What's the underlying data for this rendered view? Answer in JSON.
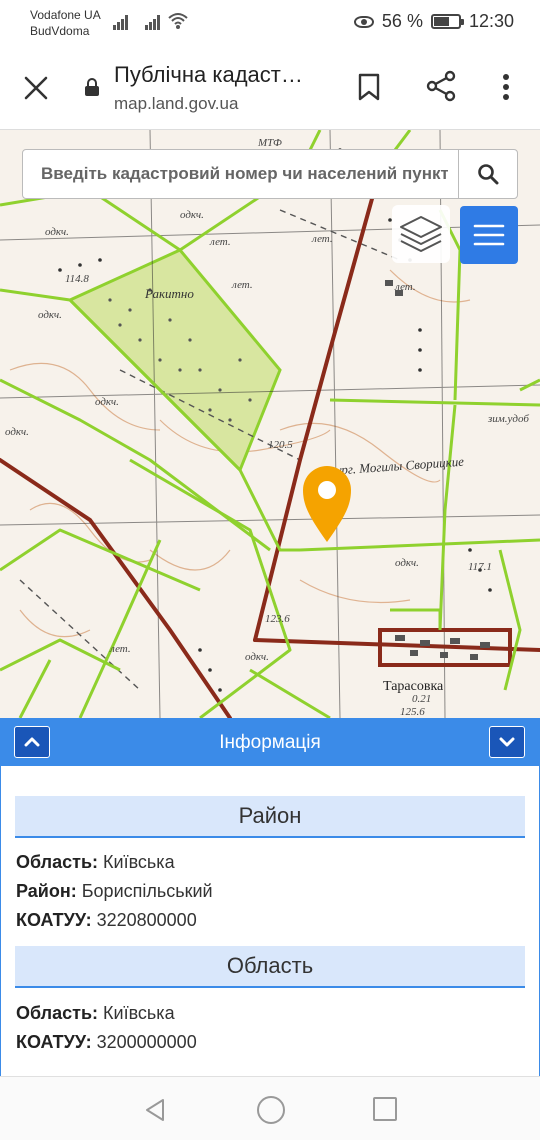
{
  "status": {
    "carrier1": "Vodafone UA",
    "carrier2": "BudVdoma",
    "battery_text": "56 %",
    "battery_level": 0.56,
    "time": "12:30"
  },
  "toolbar": {
    "title": "Публічна кадаст…",
    "url": "map.land.gov.ua",
    "close_icon": "close-icon",
    "bookmark_icon": "bookmark-icon",
    "share_icon": "share-icon",
    "more_icon": "more-vert-icon"
  },
  "map": {
    "search_placeholder": "Введіть кадастровий номер чи населений пункт",
    "labels": {
      "mtf": "МТФ",
      "odkch1": "одкч.",
      "odkch2": "одкч.",
      "odkch3": "одкч.",
      "odkch4": "одкч.",
      "odkch5": "одкч.",
      "odkch6": "одкч.",
      "odkch7": "одкч.",
      "let1": "лет.",
      "let2": "лет.",
      "let3": "лет.",
      "let4": "лет.",
      "let5": "лет.",
      "elev1": "114.8",
      "elev2": "120.5",
      "elev3": "123.6",
      "elev4": "117.1",
      "forest": "Ракитно",
      "mogily": "кург. Могилы Сворицкие",
      "zim": "зим.удоб",
      "tarasovka": "Тарасовка",
      "tarasovka_num": "0.21",
      "tarasovka_num2": "125.6"
    },
    "accent": "#f5a300",
    "parcel_color": "#8fd12e",
    "road_color": "#8a2a1a"
  },
  "info": {
    "title": "Інформація",
    "sections": [
      {
        "heading": "Район",
        "fields": [
          {
            "label": "Область:",
            "value": "Київська"
          },
          {
            "label": "Район:",
            "value": "Бориспільський"
          },
          {
            "label": "КОАТУУ:",
            "value": "3220800000"
          }
        ]
      },
      {
        "heading": "Область",
        "fields": [
          {
            "label": "Область:",
            "value": "Київська"
          },
          {
            "label": "КОАТУУ:",
            "value": "3200000000"
          }
        ]
      }
    ]
  }
}
